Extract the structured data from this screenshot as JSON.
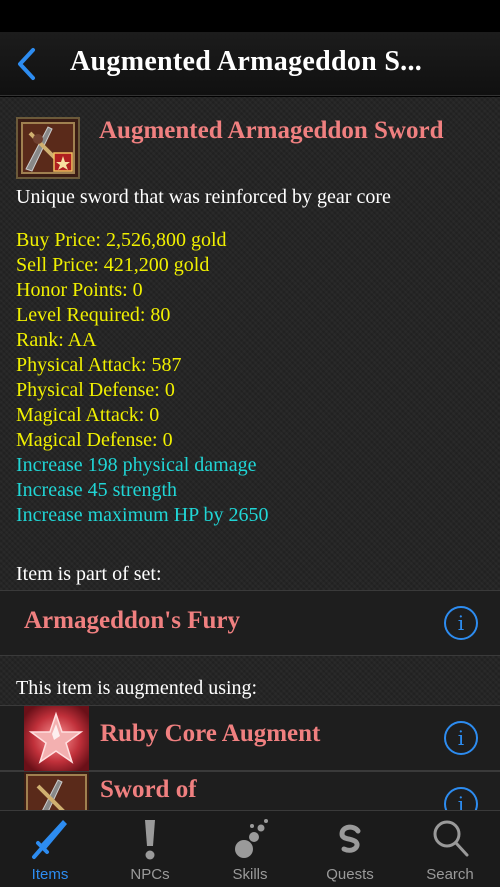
{
  "nav": {
    "title": "Augmented Armageddon S...",
    "back_icon": "chevron-left-icon"
  },
  "item": {
    "name": "Augmented Armageddon Sword",
    "description": "Unique sword that was reinforced by gear core",
    "stats": [
      "Buy Price: 2,526,800 gold",
      "Sell Price: 421,200 gold",
      "Honor Points: 0",
      "Level Required: 80",
      "Rank: AA",
      "Physical Attack: 587",
      "Physical Defense: 0",
      "Magical Attack: 0",
      "Magical Defense: 0"
    ],
    "bonuses": [
      "Increase 198 physical damage",
      "Increase 45 strength",
      "Increase maximum HP by 2650"
    ]
  },
  "set_section": {
    "label": "Item is part of set:",
    "name": "Armageddon's Fury"
  },
  "augment_section": {
    "label": "This item is augmented using:",
    "items": [
      {
        "name": "Ruby Core Augment"
      },
      {
        "name": "Sword of"
      }
    ]
  },
  "info_glyph": "i",
  "tabs": [
    {
      "label": "Items",
      "icon": "sword-icon",
      "active": true
    },
    {
      "label": "NPCs",
      "icon": "exclamation-icon",
      "active": false
    },
    {
      "label": "Skills",
      "icon": "fireball-icon",
      "active": false
    },
    {
      "label": "Quests",
      "icon": "quests-icon",
      "active": false
    },
    {
      "label": "Search",
      "icon": "search-icon",
      "active": false
    }
  ],
  "colors": {
    "accent": "#2d8cf0",
    "item_name": "#f08080",
    "stat_text": "#f0f000",
    "bonus_text": "#20d6d6"
  }
}
